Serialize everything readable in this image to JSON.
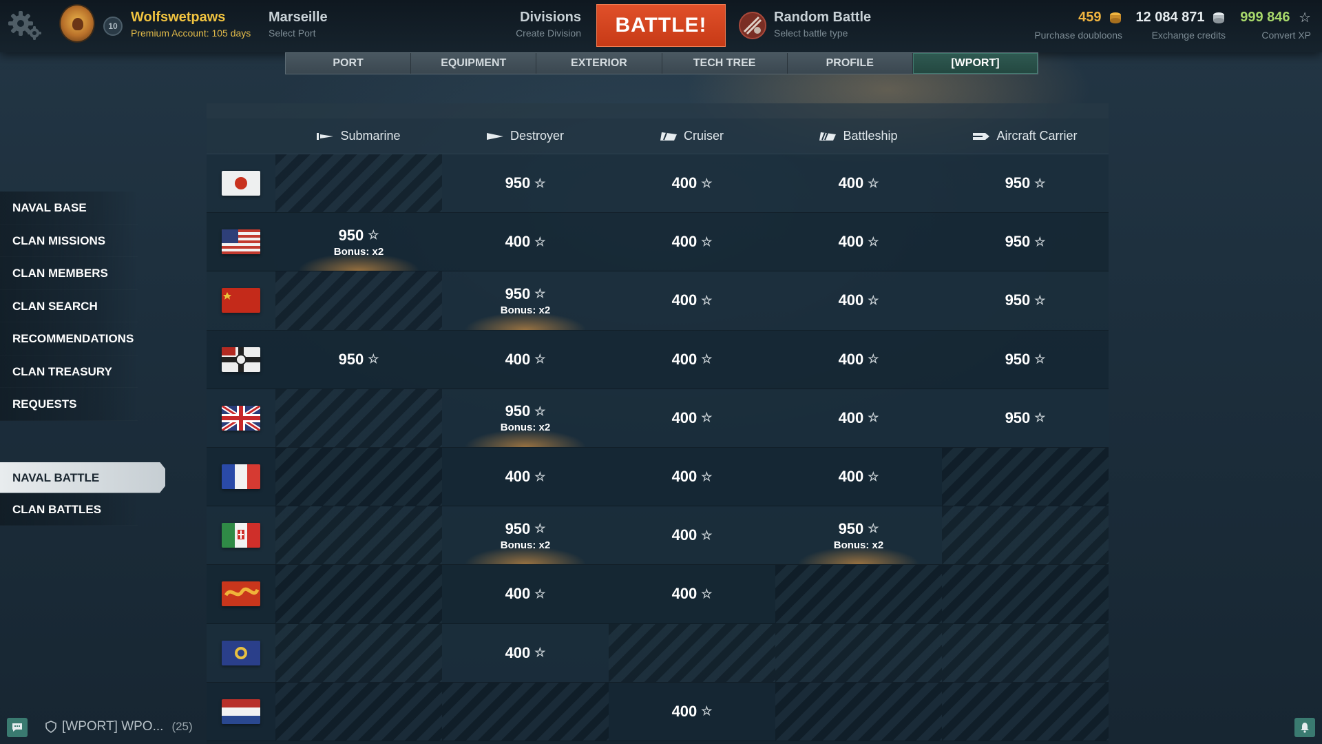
{
  "topbar": {
    "username": "Wolfswetpaws",
    "premium": "Premium Account: 105 days",
    "rank": "10",
    "port_name": "Marseille",
    "port_sub": "Select Port",
    "divisions_title": "Divisions",
    "divisions_sub": "Create Division",
    "battle_label": "BATTLE!",
    "battle_type_title": "Random Battle",
    "battle_type_sub": "Select battle type",
    "doubloons": "459",
    "doubloons_sub": "Purchase doubloons",
    "credits": "12 084 871",
    "credits_sub": "Exchange credits",
    "xp": "999 846",
    "xp_sub": "Convert XP",
    "colors": {
      "doubloons": "#f0b540",
      "xp": "#a8d96b",
      "battle": "#d3461f",
      "accent": "#f0c340"
    }
  },
  "tabs": [
    "PORT",
    "EQUIPMENT",
    "EXTERIOR",
    "TECH TREE",
    "PROFILE",
    "[WPORT]"
  ],
  "active_tab": "[WPORT]",
  "sidebar": {
    "items": [
      "NAVAL BASE",
      "CLAN MISSIONS",
      "CLAN MEMBERS",
      "CLAN SEARCH",
      "RECOMMENDATIONS",
      "CLAN TREASURY",
      "REQUESTS"
    ],
    "battle_items": [
      "NAVAL BATTLE",
      "CLAN BATTLES"
    ],
    "active": "NAVAL BATTLE"
  },
  "table": {
    "columns": [
      {
        "label": "Submarine",
        "icon": "submarine-icon"
      },
      {
        "label": "Destroyer",
        "icon": "destroyer-icon"
      },
      {
        "label": "Cruiser",
        "icon": "cruiser-icon"
      },
      {
        "label": "Battleship",
        "icon": "battleship-icon"
      },
      {
        "label": "Aircraft Carrier",
        "icon": "aircraft-carrier-icon"
      }
    ],
    "rows": [
      {
        "flag": "japan-flag",
        "cells": [
          null,
          {
            "value": "950"
          },
          {
            "value": "400"
          },
          {
            "value": "400"
          },
          {
            "value": "950"
          }
        ]
      },
      {
        "flag": "usa-flag",
        "cells": [
          {
            "value": "950",
            "bonus": "Bonus: x2"
          },
          {
            "value": "400"
          },
          {
            "value": "400"
          },
          {
            "value": "400"
          },
          {
            "value": "950"
          }
        ]
      },
      {
        "flag": "ussr-flag",
        "cells": [
          null,
          {
            "value": "950",
            "bonus": "Bonus: x2"
          },
          {
            "value": "400"
          },
          {
            "value": "400"
          },
          {
            "value": "950"
          }
        ]
      },
      {
        "flag": "germany-flag",
        "cells": [
          {
            "value": "950"
          },
          {
            "value": "400"
          },
          {
            "value": "400"
          },
          {
            "value": "400"
          },
          {
            "value": "950"
          }
        ]
      },
      {
        "flag": "uk-flag",
        "cells": [
          null,
          {
            "value": "950",
            "bonus": "Bonus: x2"
          },
          {
            "value": "400"
          },
          {
            "value": "400"
          },
          {
            "value": "950"
          }
        ]
      },
      {
        "flag": "france-flag",
        "cells": [
          null,
          {
            "value": "400"
          },
          {
            "value": "400"
          },
          {
            "value": "400"
          },
          null
        ]
      },
      {
        "flag": "italy-flag",
        "cells": [
          null,
          {
            "value": "950",
            "bonus": "Bonus: x2"
          },
          {
            "value": "400"
          },
          {
            "value": "950",
            "bonus": "Bonus: x2"
          },
          null
        ]
      },
      {
        "flag": "pan-asia-flag",
        "cells": [
          null,
          {
            "value": "400"
          },
          {
            "value": "400"
          },
          null,
          null
        ]
      },
      {
        "flag": "europe-flag",
        "cells": [
          null,
          {
            "value": "400"
          },
          null,
          null,
          null
        ]
      },
      {
        "flag": "netherlands-flag",
        "cells": [
          null,
          null,
          {
            "value": "400"
          },
          null,
          null
        ]
      }
    ]
  },
  "bottom": {
    "clan_chat": "[WPORT] WPO...",
    "clan_count": "(25)"
  }
}
